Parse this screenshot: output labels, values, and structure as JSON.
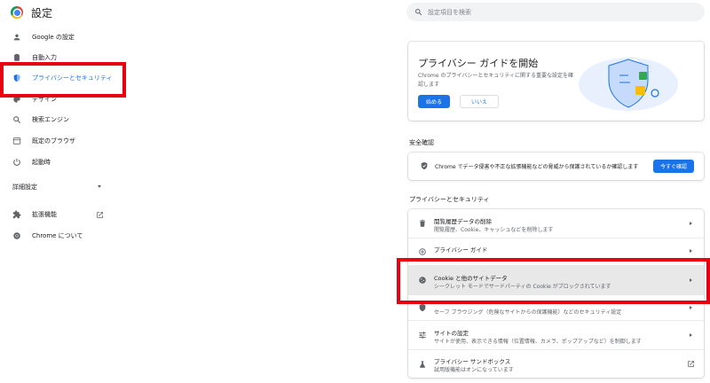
{
  "header": {
    "title": "設定",
    "search_placeholder": "設定項目を検索"
  },
  "sidebar": {
    "items": [
      {
        "label": "Google の設定",
        "icon": "person-icon"
      },
      {
        "label": "自動入力",
        "icon": "clipboard-icon"
      },
      {
        "label": "プライバシーとセキュリティ",
        "icon": "shield-icon",
        "active": true
      },
      {
        "label": "デザイン",
        "icon": "palette-icon"
      },
      {
        "label": "検索エンジン",
        "icon": "search-icon"
      },
      {
        "label": "既定のブラウザ",
        "icon": "browser-icon"
      },
      {
        "label": "起動時",
        "icon": "power-icon"
      }
    ],
    "advanced_label": "詳細設定",
    "extensions_label": "拡張機能",
    "about_label": "Chrome について"
  },
  "privacy_guide": {
    "title": "プライバシー ガイドを開始",
    "description": "Chrome のプライバシーとセキュリティに関する重要な設定を確認します",
    "start_label": "始める",
    "no_label": "いいえ"
  },
  "safety_check": {
    "section_title": "安全確認",
    "text": "Chrome でデータ侵害や不正な拡張機能などの脅威から保護されているか確認します",
    "button_label": "今すぐ確認"
  },
  "privacy_section": {
    "title": "プライバシーとセキュリティ",
    "rows": [
      {
        "title": "閲覧履歴データの削除",
        "sub": "閲覧履歴、Cookie、キャッシュなどを削除します",
        "icon": "trash-icon"
      },
      {
        "title": "プライバシー ガイド",
        "sub": "",
        "icon": "guide-icon"
      },
      {
        "title": "Cookie と他のサイトデータ",
        "sub": "シークレット モードでサードパーティの Cookie がブロックされています",
        "icon": "cookie-icon"
      },
      {
        "title": "",
        "sub": "セーフ ブラウジング（危険なサイトからの保護機能）などのセキュリティ設定",
        "icon": "security-icon"
      },
      {
        "title": "サイトの設定",
        "sub": "サイトが使用、表示できる情報（位置情報、カメラ、ポップアップなど）を制御します",
        "icon": "sliders-icon"
      },
      {
        "title": "プライバシー サンドボックス",
        "sub": "試用版機能はオンになっています",
        "icon": "flask-icon"
      }
    ]
  },
  "colors": {
    "accent": "#1a73e8",
    "highlight": "#e60012"
  }
}
